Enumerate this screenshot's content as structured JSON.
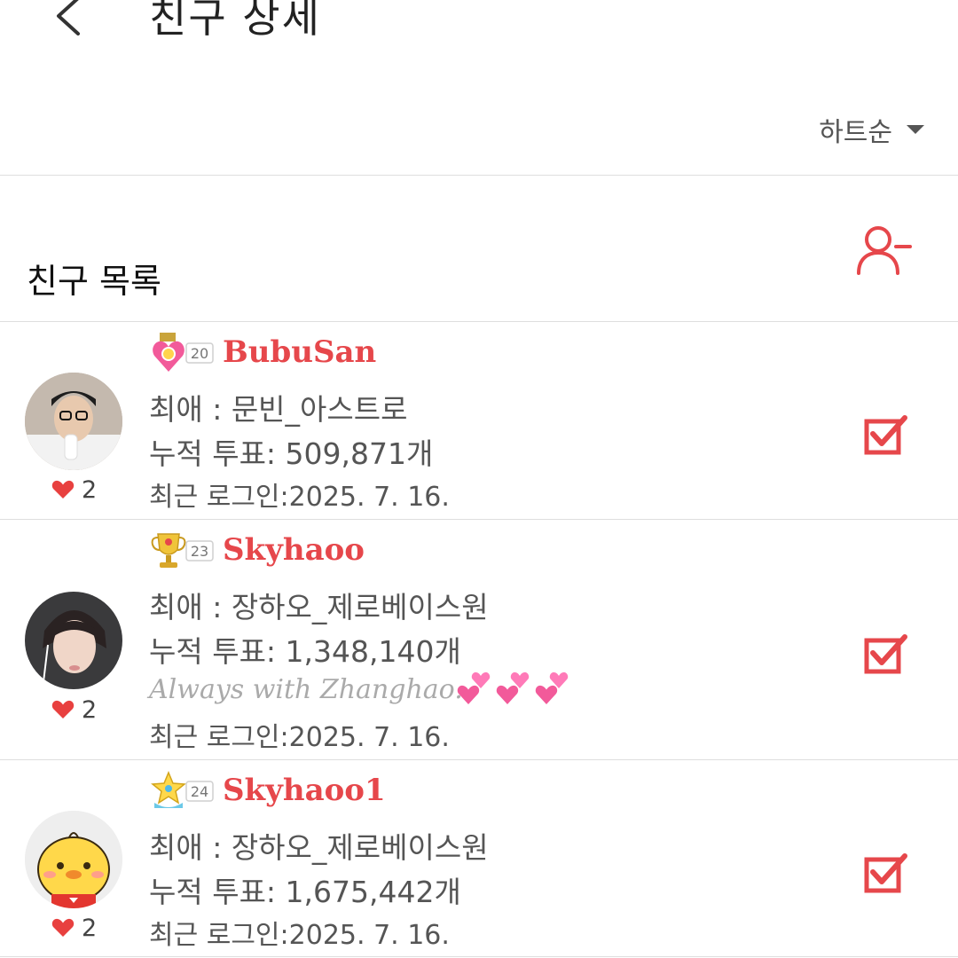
{
  "header": {
    "back_icon": "chevron-left-icon",
    "title": "친구 상세"
  },
  "sort": {
    "label": "하트순",
    "icon": "caret-down-icon"
  },
  "friends_section": {
    "title": "친구 목록",
    "remove_icon": "person-minus-icon"
  },
  "colors": {
    "accent": "#e6474b",
    "heart": "#e8403f",
    "divider": "#dedede"
  },
  "friends": [
    {
      "nickname": "BubuSan",
      "level": "20",
      "badge_icon": "heart-medal-icon",
      "favorite": "최애 : 문빈_아스트로",
      "votes": "누적 투표: 509,871개",
      "last_login": "최근 로그인:2025. 7. 16.",
      "hearts": "2",
      "status_message": "",
      "checked": true
    },
    {
      "nickname": "Skyhaoo",
      "level": "23",
      "badge_icon": "trophy-icon",
      "favorite": "최애 : 장하오_제로베이스원",
      "votes": "누적 투표: 1,348,140개",
      "last_login": "최근 로그인:2025. 7. 16.",
      "hearts": "2",
      "status_message": "Always with Zhanghao.",
      "status_emoji": "two-hearts-icon",
      "checked": true
    },
    {
      "nickname": "Skyhaoo1",
      "level": "24",
      "badge_icon": "star-badge-icon",
      "favorite": "최애 : 장하오_제로베이스원",
      "votes": "누적 투표: 1,675,442개",
      "last_login": "최근 로그인:2025. 7. 16.",
      "hearts": "2",
      "status_message": "",
      "checked": true
    }
  ]
}
